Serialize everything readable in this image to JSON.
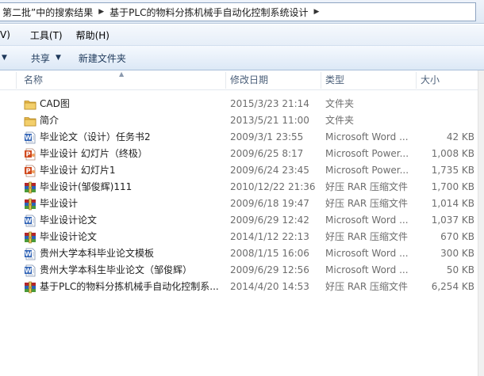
{
  "breadcrumb": {
    "items": [
      "第二批”中的搜索结果",
      "基于PLC的物料分拣机械手自动化控制系统设计"
    ]
  },
  "menubar": {
    "items": [
      "V)",
      "工具(T)",
      "帮助(H)"
    ]
  },
  "toolbar": {
    "share_label": "共享",
    "new_folder_label": "新建文件夹"
  },
  "columns": {
    "name": "名称",
    "date": "修改日期",
    "type": "类型",
    "size": "大小"
  },
  "files": [
    {
      "name": "CAD图",
      "date": "2015/3/23 21:14",
      "type": "文件夹",
      "size": "",
      "icon": "folder-icon"
    },
    {
      "name": "简介",
      "date": "2013/5/21 11:00",
      "type": "文件夹",
      "size": "",
      "icon": "folder-icon"
    },
    {
      "name": "毕业论文（设计）任务书2",
      "date": "2009/3/1 23:55",
      "type": "Microsoft Word ...",
      "size": "42 KB",
      "icon": "word-doc-icon"
    },
    {
      "name": "毕业设计 幻灯片（终极）",
      "date": "2009/6/25 8:17",
      "type": "Microsoft Power...",
      "size": "1,008 KB",
      "icon": "powerpoint-icon"
    },
    {
      "name": "毕业设计 幻灯片1",
      "date": "2009/6/24 23:45",
      "type": "Microsoft Power...",
      "size": "1,735 KB",
      "icon": "powerpoint-icon"
    },
    {
      "name": "毕业设计(邹俊辉)111",
      "date": "2010/12/22 21:36",
      "type": "好压 RAR 压缩文件",
      "size": "1,700 KB",
      "icon": "rar-archive-icon"
    },
    {
      "name": "毕业设计",
      "date": "2009/6/18 19:47",
      "type": "好压 RAR 压缩文件",
      "size": "1,014 KB",
      "icon": "rar-archive-icon"
    },
    {
      "name": "毕业设计论文",
      "date": "2009/6/29 12:42",
      "type": "Microsoft Word ...",
      "size": "1,037 KB",
      "icon": "word-doc-icon"
    },
    {
      "name": "毕业设计论文",
      "date": "2014/1/12 22:13",
      "type": "好压 RAR 压缩文件",
      "size": "670 KB",
      "icon": "rar-archive-icon"
    },
    {
      "name": "贵州大学本科毕业论文模板",
      "date": "2008/1/15 16:06",
      "type": "Microsoft Word ...",
      "size": "300 KB",
      "icon": "word-doc-icon"
    },
    {
      "name": "贵州大学本科生毕业论文（邹俊辉）",
      "date": "2009/6/29 12:56",
      "type": "Microsoft Word ...",
      "size": "50 KB",
      "icon": "word-doc-icon"
    },
    {
      "name": "基于PLC的物料分拣机械手自动化控制系...",
      "date": "2014/4/20 14:53",
      "type": "好压 RAR 压缩文件",
      "size": "6,254 KB",
      "icon": "rar-archive-icon"
    }
  ],
  "colors": {
    "folder": "#e8b84a",
    "word": "#2b5fb4",
    "powerpoint": "#d04a1f",
    "rar_red": "#b3262a",
    "rar_blue": "#2c63b5",
    "rar_green": "#4a9a3a"
  }
}
